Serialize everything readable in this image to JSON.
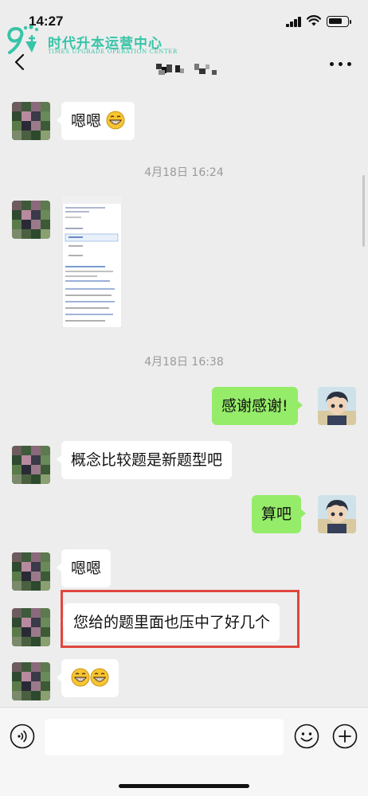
{
  "status_bar": {
    "time": "14:27"
  },
  "watermark": {
    "title": "时代升本运营中心",
    "subtitle": "TIMES UPGRADE OPERATION CENTER"
  },
  "nav": {
    "back_icon": "chevron-left-icon",
    "more_icon": "more-icon"
  },
  "timestamps": [
    "4月18日 16:24",
    "4月18日 16:38"
  ],
  "messages": {
    "m1": "嗯嗯",
    "m3": "感谢感谢!",
    "m4": "概念比较题是新题型吧",
    "m5": "算吧",
    "m6": "嗯嗯",
    "m7": "您给的题里面也压中了好几个"
  },
  "colors": {
    "sent_bubble": "#95ec69",
    "received_bubble": "#ffffff",
    "background": "#ededed",
    "highlight": "#e0463d",
    "watermark": "#38c4a8"
  }
}
